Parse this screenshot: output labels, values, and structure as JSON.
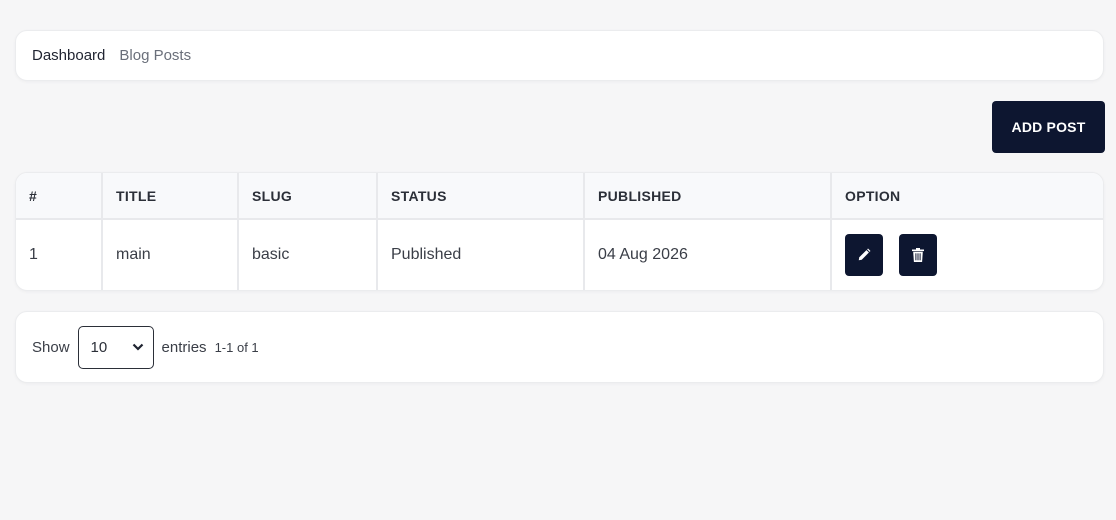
{
  "breadcrumb": {
    "items": [
      "Dashboard",
      "Blog Posts"
    ]
  },
  "toolbar": {
    "add_label": "ADD POST"
  },
  "table": {
    "headers": [
      "#",
      "TITLE",
      "SLUG",
      "STATUS",
      "PUBLISHED",
      "OPTION"
    ],
    "rows": [
      {
        "num": "1",
        "title": "main",
        "slug": "basic",
        "status": "Published",
        "published": "04 Aug 2026"
      }
    ]
  },
  "actions": {
    "edit_icon": "pencil-icon",
    "delete_icon": "trash-icon"
  },
  "pagination": {
    "show_label": "Show",
    "page_size": "10",
    "entries_label": "entries",
    "range_text": "1-1 of 1"
  },
  "colors": {
    "primary": "#0d1630",
    "background": "#f6f6f7",
    "card": "#ffffff"
  }
}
